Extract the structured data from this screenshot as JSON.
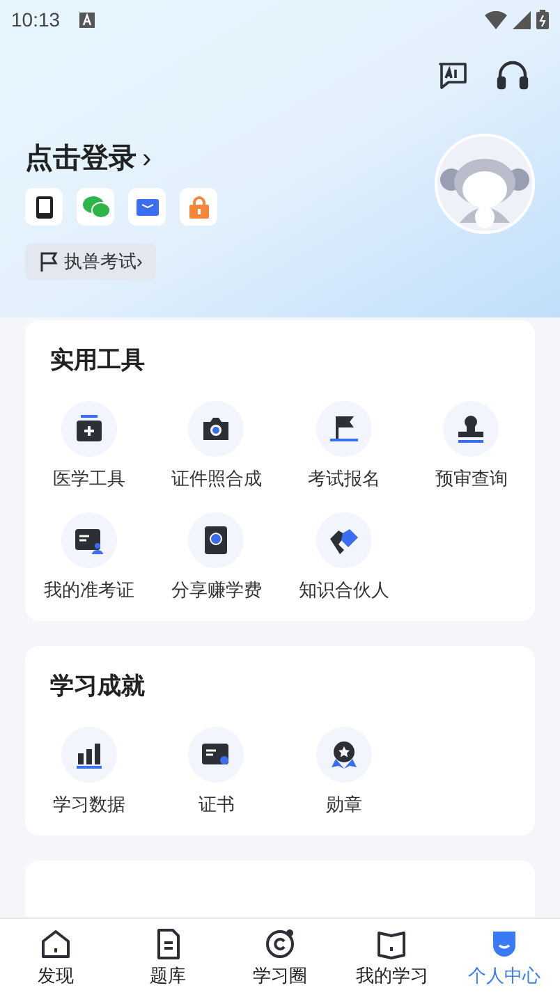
{
  "status_bar": {
    "time": "10:13"
  },
  "login": {
    "title": "点击登录",
    "arrow": "›",
    "exam_tag": "执兽考试",
    "tag_arrow": "›"
  },
  "sections": [
    {
      "title": "实用工具",
      "items": [
        {
          "label": "医学工具"
        },
        {
          "label": "证件照合成"
        },
        {
          "label": "考试报名"
        },
        {
          "label": "预审查询"
        },
        {
          "label": "我的准考证"
        },
        {
          "label": "分享赚学费"
        },
        {
          "label": "知识合伙人"
        }
      ]
    },
    {
      "title": "学习成就",
      "items": [
        {
          "label": "学习数据"
        },
        {
          "label": "证书"
        },
        {
          "label": "勋章"
        }
      ]
    }
  ],
  "tabs": [
    {
      "label": "发现",
      "selected": false
    },
    {
      "label": "题库",
      "selected": false
    },
    {
      "label": "学习圈",
      "selected": false
    },
    {
      "label": "我的学习",
      "selected": false
    },
    {
      "label": "个人中心",
      "selected": true
    }
  ]
}
